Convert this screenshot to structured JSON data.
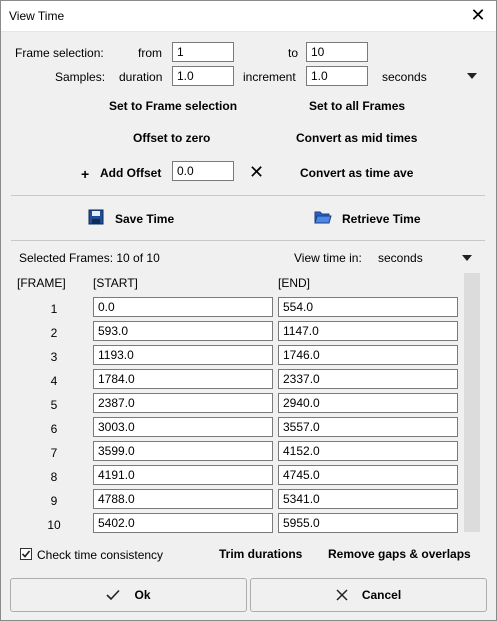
{
  "window": {
    "title": "View Time"
  },
  "frame_selection": {
    "label": "Frame selection:",
    "from_label": "from",
    "from_value": "1",
    "to_label": "to",
    "to_value": "10"
  },
  "samples": {
    "label": "Samples:",
    "duration_label": "duration",
    "duration_value": "1.0",
    "increment_label": "increment",
    "increment_value": "1.0",
    "unit": "seconds"
  },
  "actions": {
    "set_to_frame_selection": "Set to Frame selection",
    "set_to_all_frames": "Set to all Frames",
    "offset_to_zero": "Offset to zero",
    "convert_mid_times": "Convert as mid times",
    "add_offset_label": "Add Offset",
    "add_offset_value": "0.0",
    "convert_time_ave": "Convert as time ave",
    "save_time": "Save Time",
    "retrieve_time": "Retrieve Time"
  },
  "table": {
    "selected_frames": "Selected Frames: 10 of 10",
    "view_time_label": "View time in:",
    "view_time_unit": "seconds",
    "headers": [
      "[FRAME]",
      "[START]",
      "[END]"
    ],
    "rows": [
      {
        "frame": "1",
        "start": "0.0",
        "end": "554.0"
      },
      {
        "frame": "2",
        "start": "593.0",
        "end": "1147.0"
      },
      {
        "frame": "3",
        "start": "1193.0",
        "end": "1746.0"
      },
      {
        "frame": "4",
        "start": "1784.0",
        "end": "2337.0"
      },
      {
        "frame": "5",
        "start": "2387.0",
        "end": "2940.0"
      },
      {
        "frame": "6",
        "start": "3003.0",
        "end": "3557.0"
      },
      {
        "frame": "7",
        "start": "3599.0",
        "end": "4152.0"
      },
      {
        "frame": "8",
        "start": "4191.0",
        "end": "4745.0"
      },
      {
        "frame": "9",
        "start": "4788.0",
        "end": "5341.0"
      },
      {
        "frame": "10",
        "start": "5402.0",
        "end": "5955.0"
      }
    ]
  },
  "footer": {
    "check_time_consistency": "Check time consistency",
    "check_time_consistency_checked": true,
    "trim_durations": "Trim durations",
    "remove_gaps": "Remove gaps & overlaps",
    "ok": "Ok",
    "cancel": "Cancel"
  }
}
